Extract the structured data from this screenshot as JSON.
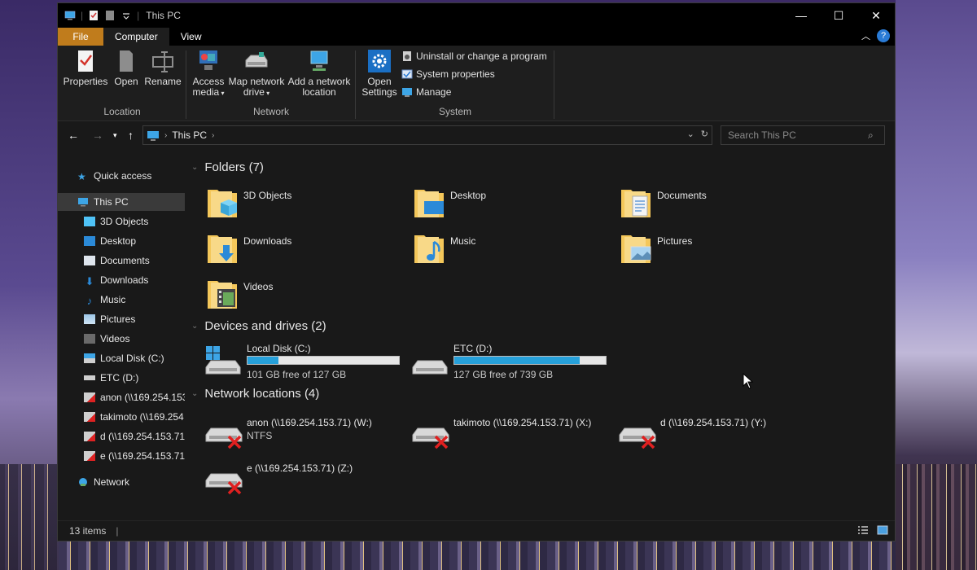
{
  "window": {
    "title": "This PC",
    "controls": {
      "minimize": "—",
      "maximize": "☐",
      "close": "✕"
    }
  },
  "ribbon": {
    "tabs": [
      "File",
      "Computer",
      "View"
    ],
    "active_tab": "Computer",
    "help": "?",
    "groups": {
      "location": {
        "label": "Location",
        "buttons": {
          "properties": "Properties",
          "open": "Open",
          "rename": "Rename"
        }
      },
      "network": {
        "label": "Network",
        "buttons": {
          "access_media_1": "Access",
          "access_media_2": "media",
          "map_drive_1": "Map network",
          "map_drive_2": "drive",
          "add_location_1": "Add a network",
          "add_location_2": "location"
        }
      },
      "system": {
        "label": "System",
        "buttons": {
          "open_settings_1": "Open",
          "open_settings_2": "Settings",
          "uninstall": "Uninstall or change a program",
          "system_properties": "System properties",
          "manage": "Manage"
        }
      }
    }
  },
  "address": {
    "crumb": "This PC",
    "search_placeholder": "Search This PC"
  },
  "nav": {
    "quick_access": "Quick access",
    "this_pc": "This PC",
    "items": [
      "3D Objects",
      "Desktop",
      "Documents",
      "Downloads",
      "Music",
      "Pictures",
      "Videos",
      "Local Disk (C:)",
      "ETC (D:)",
      "anon (\\\\169.254.153",
      "takimoto (\\\\169.254",
      "d (\\\\169.254.153.71)",
      "e (\\\\169.254.153.71)"
    ],
    "network": "Network"
  },
  "content": {
    "folders_header": "Folders (7)",
    "folders": [
      "3D Objects",
      "Desktop",
      "Documents",
      "Downloads",
      "Music",
      "Pictures",
      "Videos"
    ],
    "devices_header": "Devices and drives (2)",
    "drives": [
      {
        "name": "Local Disk (C:)",
        "free": "101 GB free of 127 GB",
        "used_fraction": 0.205
      },
      {
        "name": "ETC (D:)",
        "free": "127 GB free of 739 GB",
        "used_fraction": 0.828
      }
    ],
    "network_header": "Network locations (4)",
    "network_locations": [
      {
        "name": "anon (\\\\169.254.153.71) (W:)",
        "sub": "NTFS"
      },
      {
        "name": "takimoto (\\\\169.254.153.71) (X:)",
        "sub": ""
      },
      {
        "name": "d (\\\\169.254.153.71) (Y:)",
        "sub": ""
      },
      {
        "name": "e (\\\\169.254.153.71) (Z:)",
        "sub": ""
      }
    ]
  },
  "status": {
    "items": "13 items"
  },
  "colors": {
    "accent": "#26a0da",
    "file_tab": "#c07c1c",
    "folder": "#f4c75a"
  }
}
